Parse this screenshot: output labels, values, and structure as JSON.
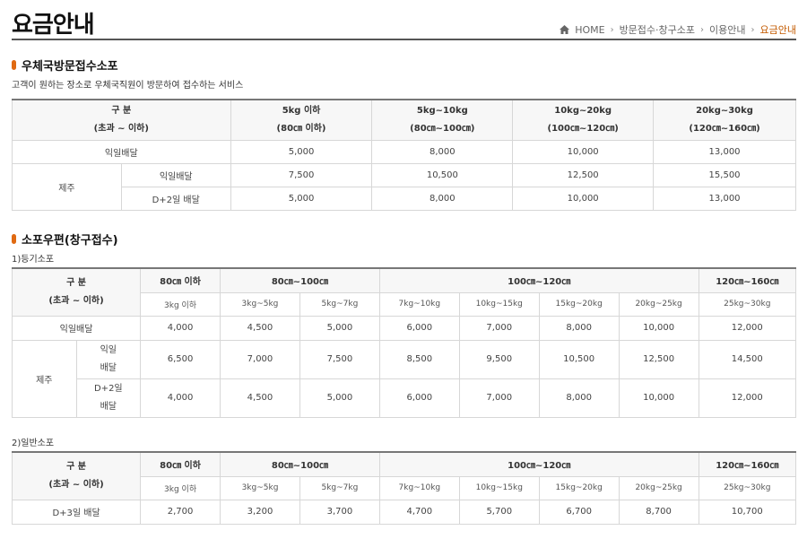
{
  "page": {
    "title": "요금안내",
    "breadcrumb": [
      "HOME",
      "방문접수·창구소포",
      "이용안내",
      "요금안내"
    ]
  },
  "section1": {
    "title": "우체국방문접수소포",
    "description": "고객이 원하는 장소로 우체국직원이 방문하여 접수하는 서비스",
    "header": {
      "category_line1": "구 분",
      "category_line2": "(초과 ~ 이하)",
      "cols": [
        {
          "weight": "5kg 이하",
          "size": "(80㎝ 이하)"
        },
        {
          "weight": "5kg~10kg",
          "size": "(80㎝~100㎝)"
        },
        {
          "weight": "10kg~20kg",
          "size": "(100㎝~120㎝)"
        },
        {
          "weight": "20kg~30kg",
          "size": "(120㎝~160㎝)"
        }
      ]
    },
    "rows": {
      "next_day": {
        "label": "익일배달",
        "values": [
          "5,000",
          "8,000",
          "10,000",
          "13,000"
        ]
      },
      "jeju": "제주",
      "jeju_next_day": {
        "label": "익일배달",
        "values": [
          "7,500",
          "10,500",
          "12,500",
          "15,500"
        ]
      },
      "jeju_d2": {
        "label": "D+2일 배달",
        "values": [
          "5,000",
          "8,000",
          "10,000",
          "13,000"
        ]
      }
    }
  },
  "section2": {
    "title": "소포우편(창구접수)",
    "sub1": "1)등기소포",
    "sub2": "2)일반소포",
    "header": {
      "category_line1": "구 분",
      "category_line2": "(초과 ~ 이하)",
      "size_groups": [
        "80㎝ 이하",
        "80㎝~100㎝",
        "100㎝~120㎝",
        "120㎝~160㎝"
      ],
      "weights": [
        "3kg 이하",
        "3kg~5kg",
        "5kg~7kg",
        "7kg~10kg",
        "10kg~15kg",
        "15kg~20kg",
        "20kg~25kg",
        "25kg~30kg"
      ]
    },
    "registered": {
      "next_day": {
        "label": "익일배달",
        "values": [
          "4,000",
          "4,500",
          "5,000",
          "6,000",
          "7,000",
          "8,000",
          "10,000",
          "12,000"
        ]
      },
      "jeju": "제주",
      "jeju_next_day": {
        "label1": "익일",
        "label2": "배달",
        "values": [
          "6,500",
          "7,000",
          "7,500",
          "8,500",
          "9,500",
          "10,500",
          "12,500",
          "14,500"
        ]
      },
      "jeju_d2": {
        "label1": "D+2일",
        "label2": "배달",
        "values": [
          "4,000",
          "4,500",
          "5,000",
          "6,000",
          "7,000",
          "8,000",
          "10,000",
          "12,000"
        ]
      }
    },
    "general": {
      "d3": {
        "label": "D+3일 배달",
        "values": [
          "2,700",
          "3,200",
          "3,700",
          "4,700",
          "5,700",
          "6,700",
          "8,700",
          "10,700"
        ]
      }
    }
  }
}
